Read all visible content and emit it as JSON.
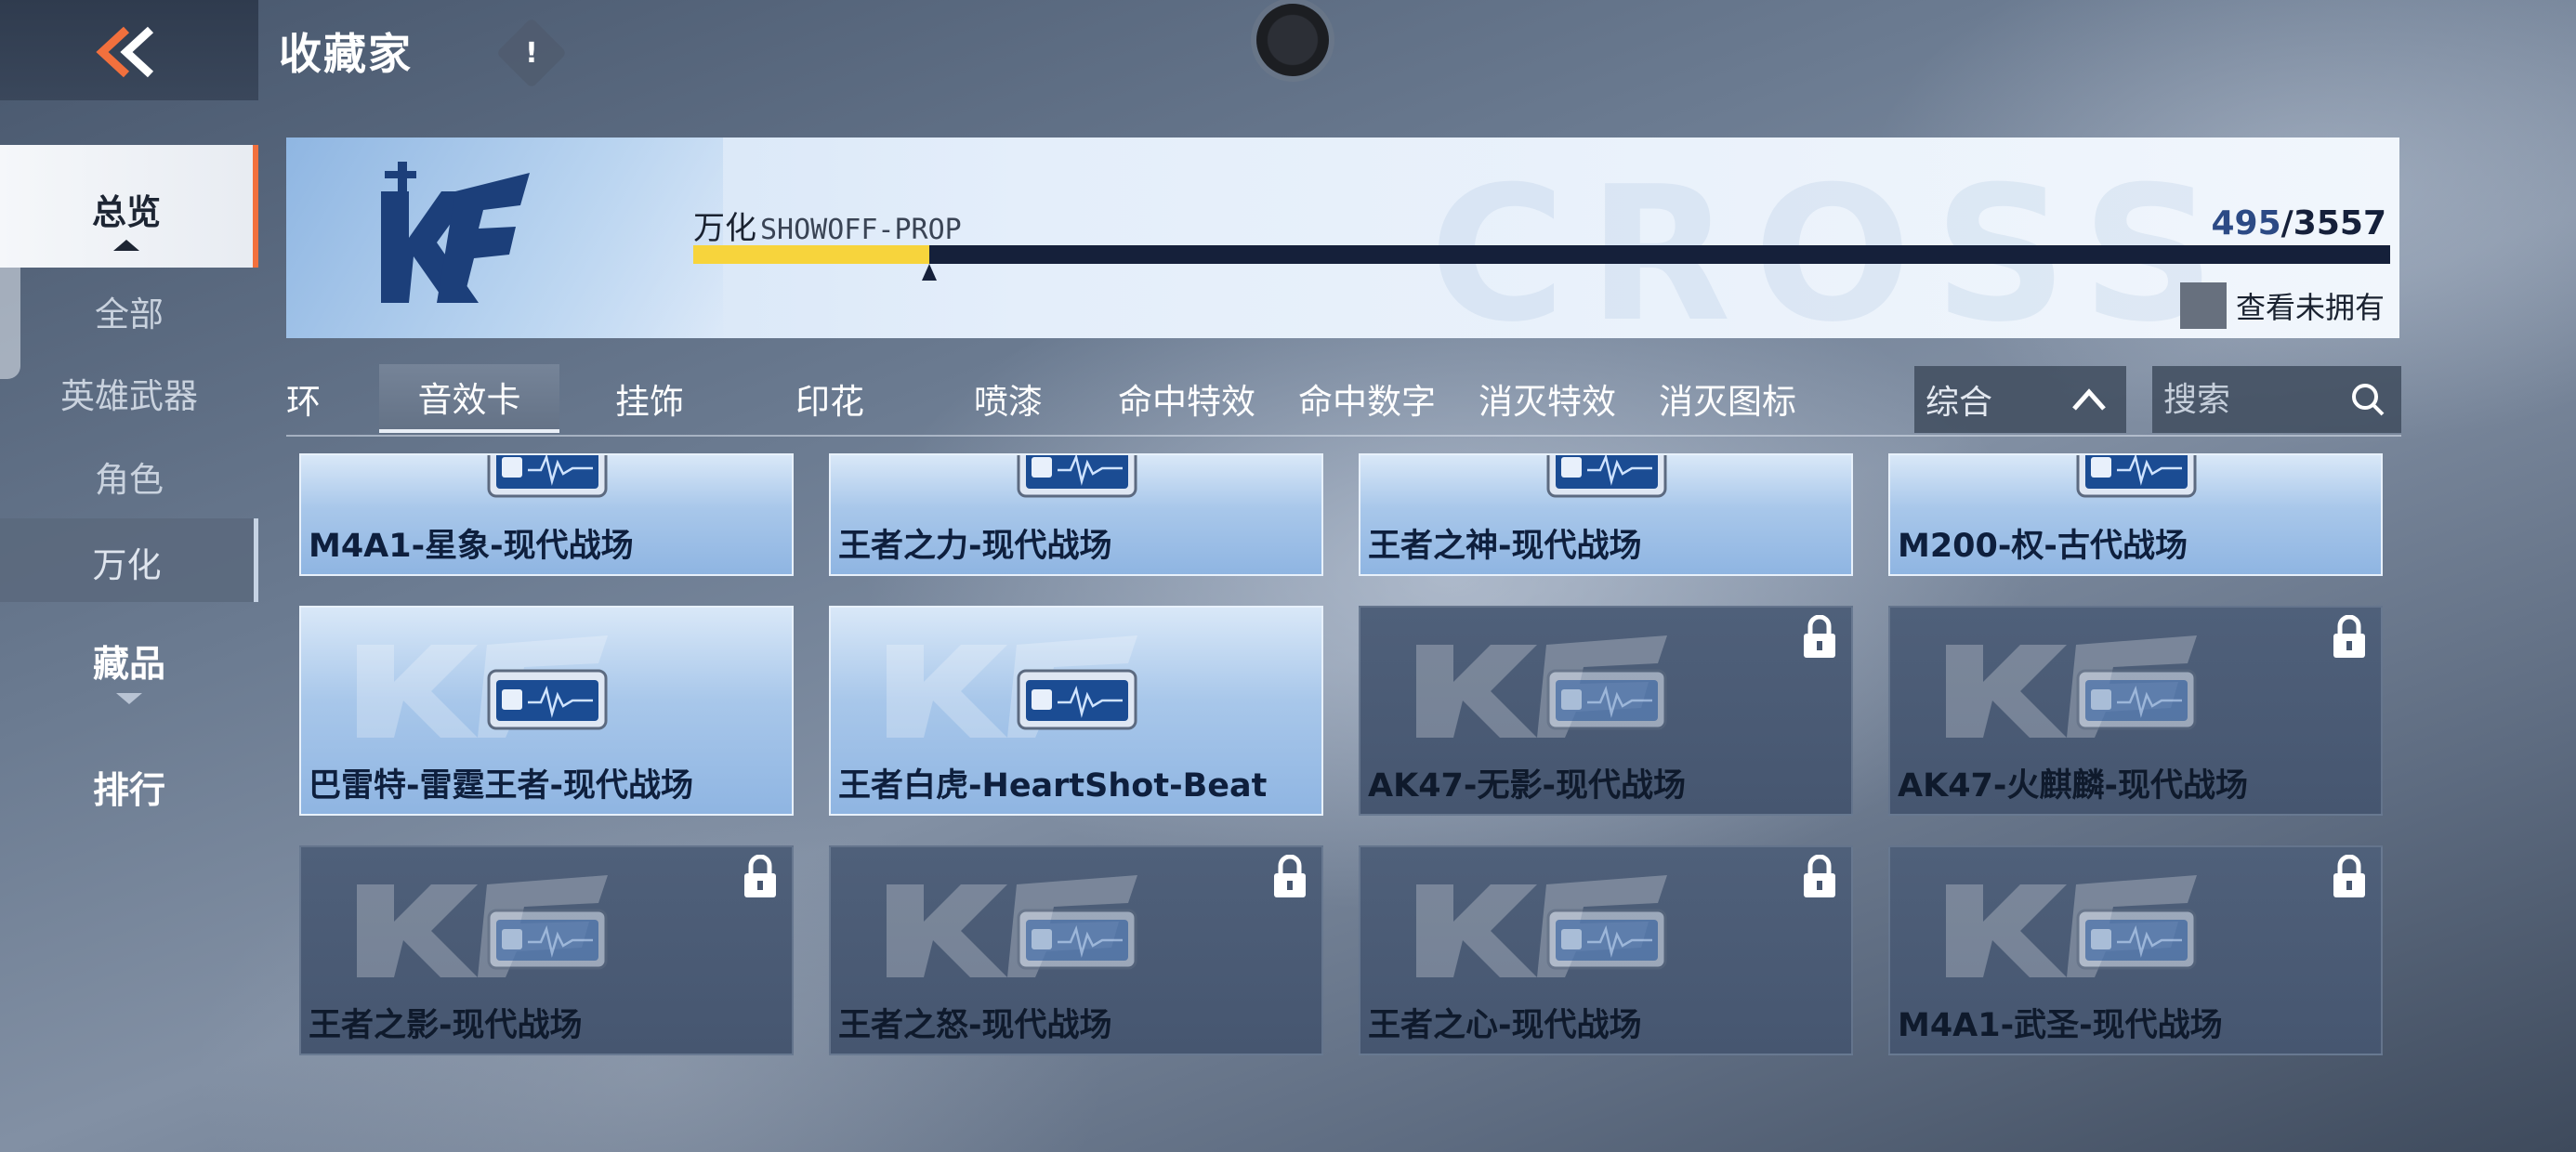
{
  "header": {
    "title": "收藏家",
    "info_label": "!"
  },
  "sidebar": {
    "items": [
      {
        "label": "总览",
        "state": "active"
      },
      {
        "label": "全部",
        "state": "normal"
      },
      {
        "label": "英雄武器",
        "state": "normal"
      },
      {
        "label": "角色",
        "state": "normal"
      },
      {
        "label": "万化",
        "state": "selected"
      },
      {
        "label": "藏品",
        "state": "group"
      },
      {
        "label": "排行",
        "state": "group"
      }
    ]
  },
  "banner": {
    "category": "万化",
    "subtitle": "SHOWOFF-PROP",
    "owned": "495",
    "separator": "/",
    "total": "3557",
    "progress_fraction": 0.139,
    "show_unowned_label": "查看未拥有",
    "watermark": "CROSS"
  },
  "tabs": [
    {
      "label": "环",
      "active": false
    },
    {
      "label": "音效卡",
      "active": true
    },
    {
      "label": "挂饰",
      "active": false
    },
    {
      "label": "印花",
      "active": false
    },
    {
      "label": "喷漆",
      "active": false
    },
    {
      "label": "命中特效",
      "active": false
    },
    {
      "label": "命中数字",
      "active": false
    },
    {
      "label": "消灭特效",
      "active": false
    },
    {
      "label": "消灭图标",
      "active": false
    }
  ],
  "sort": {
    "selected": "综合"
  },
  "search": {
    "placeholder": "搜索"
  },
  "items": [
    {
      "name": "M4A1-星象-现代战场",
      "locked": false
    },
    {
      "name": "王者之力-现代战场",
      "locked": false
    },
    {
      "name": "王者之神-现代战场",
      "locked": false
    },
    {
      "name": "M200-权-古代战场",
      "locked": false
    },
    {
      "name": "巴雷特-雷霆王者-现代战场",
      "locked": false
    },
    {
      "name": "王者白虎-HeartShot-Beat",
      "locked": false
    },
    {
      "name": "AK47-无影-现代战场",
      "locked": true
    },
    {
      "name": "AK47-火麒麟-现代战场",
      "locked": true
    },
    {
      "name": "王者之影-现代战场",
      "locked": true
    },
    {
      "name": "王者之怒-现代战场",
      "locked": true
    },
    {
      "name": "王者之心-现代战场",
      "locked": true
    },
    {
      "name": "M4A1-武圣-现代战场",
      "locked": true
    }
  ],
  "colors": {
    "accent": "#f2703d",
    "progress_fill": "#f7d43c",
    "progress_track": "#15203a"
  }
}
